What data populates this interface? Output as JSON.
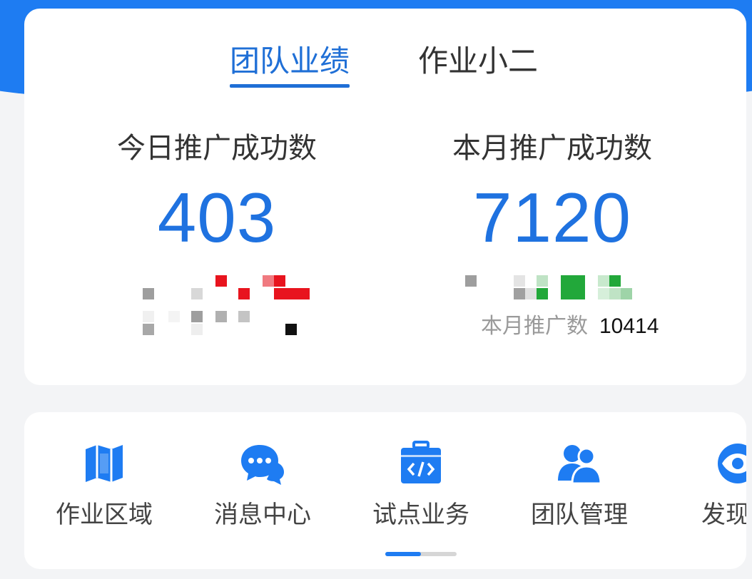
{
  "tabs": [
    {
      "label": "团队业绩",
      "active": true
    },
    {
      "label": "作业小二",
      "active": false
    }
  ],
  "stats": {
    "today": {
      "label": "今日推广成功数",
      "value": "403"
    },
    "month": {
      "label": "本月推广成功数",
      "value": "7120"
    }
  },
  "obscured_line": {
    "label": "本月推广数",
    "value": "10414"
  },
  "nav": {
    "items": [
      {
        "label": "作业区域",
        "icon": "map-icon"
      },
      {
        "label": "消息中心",
        "icon": "chat-icon"
      },
      {
        "label": "试点业务",
        "icon": "code-box-icon"
      },
      {
        "label": "团队管理",
        "icon": "team-icon"
      },
      {
        "label": "发现代",
        "icon": "eye-icon"
      }
    ]
  },
  "colors": {
    "accent": "#1e7cf2",
    "number_blue": "#1f72e0",
    "tab_active": "#1f6fd6",
    "mosaic_red": "#e8141e",
    "mosaic_green": "#22a83a"
  }
}
